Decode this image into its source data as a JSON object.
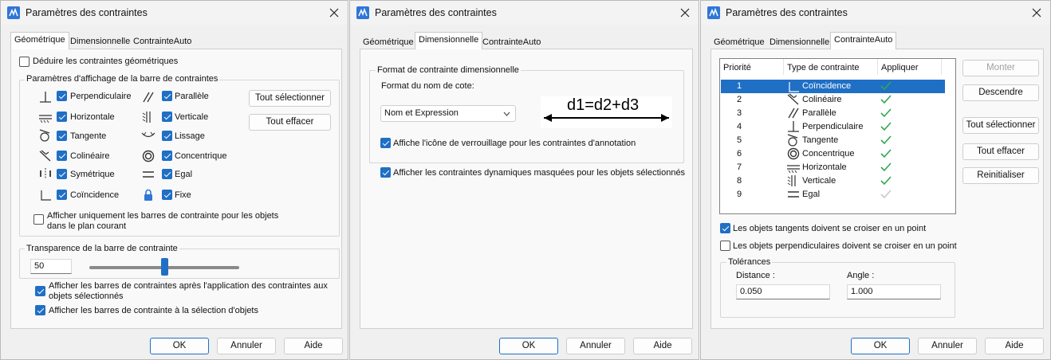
{
  "dialogs": [
    {
      "title": "Paramètres des contraintes",
      "tabs": [
        "Géométrique",
        "Dimensionnelle",
        "ContrainteAuto"
      ],
      "active_tab": "Géométrique",
      "infer_label": "Déduire les contraintes géométriques",
      "infer_checked": false,
      "bar_settings_group": "Paramètres d'affichage de la barre de contraintes",
      "constraints_left": [
        {
          "label": "Perpendiculaire",
          "icon": "perpendicular-icon",
          "checked": true
        },
        {
          "label": "Horizontale",
          "icon": "horizontal-icon",
          "checked": true
        },
        {
          "label": "Tangente",
          "icon": "tangent-icon",
          "checked": true
        },
        {
          "label": "Colinéaire",
          "icon": "collinear-icon",
          "checked": true
        },
        {
          "label": "Symétrique",
          "icon": "symmetric-icon",
          "checked": true
        },
        {
          "label": "Coïncidence",
          "icon": "coincident-icon",
          "checked": true
        }
      ],
      "constraints_right": [
        {
          "label": "Parallèle",
          "icon": "parallel-icon",
          "checked": true
        },
        {
          "label": "Verticale",
          "icon": "vertical-icon",
          "checked": true
        },
        {
          "label": "Lissage",
          "icon": "smooth-icon",
          "checked": true
        },
        {
          "label": "Concentrique",
          "icon": "concentric-icon",
          "checked": true
        },
        {
          "label": "Egal",
          "icon": "equal-icon",
          "checked": true
        },
        {
          "label": "Fixe",
          "icon": "lock-icon",
          "checked": true
        }
      ],
      "select_all": "Tout sélectionner",
      "clear_all": "Tout effacer",
      "current_plane_label_1": "Afficher uniquement les barres de contrainte pour les objets",
      "current_plane_label_2": "dans le plan courant",
      "current_plane_checked": false,
      "transparency_group": "Transparence de la barre de contrainte",
      "transparency_value": "50",
      "transparency_level": 0.5,
      "after_apply_label_1": "Afficher les barres de contraintes après l'application des contraintes aux",
      "after_apply_label_2": "objets sélectionnés",
      "after_apply_checked": true,
      "on_select_label": "Afficher les barres de contrainte à la sélection d'objets",
      "on_select_checked": true,
      "ok": "OK",
      "cancel": "Annuler",
      "help": "Aide"
    },
    {
      "title": "Paramètres des contraintes",
      "tabs": [
        "Géométrique",
        "Dimensionnelle",
        "ContrainteAuto"
      ],
      "active_tab": "Dimensionnelle",
      "format_group": "Format de contrainte dimensionnelle",
      "name_format_label": "Format du nom de cote:",
      "name_format_value": "Nom et Expression",
      "formula_preview": "d1=d2+d3",
      "lock_icon_label": "Affiche l'icône de verrouillage pour les contraintes d'annotation",
      "lock_icon_checked": true,
      "hidden_dynamic_label": "Afficher les contraintes dynamiques masquées pour les objets sélectionnés",
      "hidden_dynamic_checked": true,
      "ok": "OK",
      "cancel": "Annuler",
      "help": "Aide"
    },
    {
      "title": "Paramètres des contraintes",
      "tabs": [
        "Géométrique",
        "Dimensionnelle",
        "ContrainteAuto"
      ],
      "active_tab": "ContrainteAuto",
      "columns": [
        "Priorité",
        "Type de contrainte",
        "Appliquer"
      ],
      "rows": [
        {
          "priority": "1",
          "type": "Coïncidence",
          "icon": "coincident-icon",
          "apply": true,
          "selected": true
        },
        {
          "priority": "2",
          "type": "Colinéaire",
          "icon": "collinear-icon",
          "apply": true,
          "selected": false
        },
        {
          "priority": "3",
          "type": "Parallèle",
          "icon": "parallel-icon",
          "apply": true,
          "selected": false
        },
        {
          "priority": "4",
          "type": "Perpendiculaire",
          "icon": "perpendicular-icon",
          "apply": true,
          "selected": false
        },
        {
          "priority": "5",
          "type": "Tangente",
          "icon": "tangent-icon",
          "apply": true,
          "selected": false
        },
        {
          "priority": "6",
          "type": "Concentrique",
          "icon": "concentric-icon",
          "apply": true,
          "selected": false
        },
        {
          "priority": "7",
          "type": "Horizontale",
          "icon": "horizontal-icon",
          "apply": true,
          "selected": false
        },
        {
          "priority": "8",
          "type": "Verticale",
          "icon": "vertical-icon",
          "apply": true,
          "selected": false
        },
        {
          "priority": "9",
          "type": "Egal",
          "icon": "equal-icon",
          "apply": false,
          "selected": false
        }
      ],
      "move_up": "Monter",
      "move_down": "Descendre",
      "select_all": "Tout sélectionner",
      "clear_all": "Tout effacer",
      "reset": "Reinitialiser",
      "tangent_label": "Les objets tangents doivent se croiser en un point",
      "tangent_checked": true,
      "perp_label": "Les objets perpendiculaires doivent se croiser en un point",
      "perp_checked": false,
      "tolerances_group": "Tolérances",
      "distance_label": "Distance :",
      "distance_value": "0.050",
      "angle_label": "Angle :",
      "angle_value": "1.000",
      "ok": "OK",
      "cancel": "Annuler",
      "help": "Aide"
    }
  ],
  "colors": {
    "accent": "#1f6fc5",
    "check_green": "#2fa84f",
    "check_disabled": "#c8c8c8"
  }
}
